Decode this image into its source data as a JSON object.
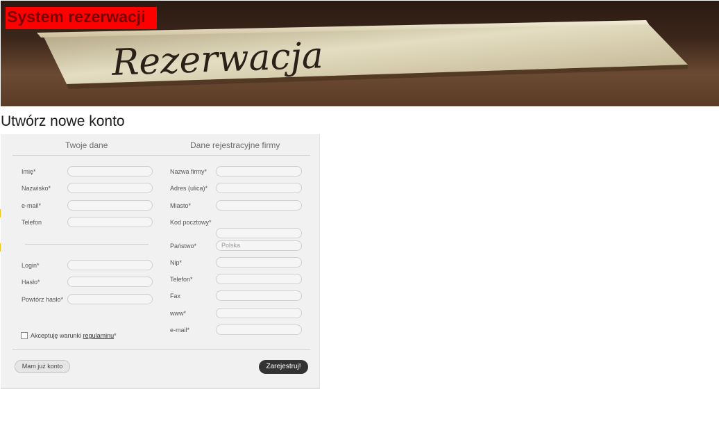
{
  "header": {
    "brand_title": "System rezerwacji",
    "banner_text": "Rezerwacja"
  },
  "page": {
    "heading": "Utwórz nowe konto"
  },
  "form": {
    "left_column_title": "Twoje dane",
    "right_column_title": "Dane rejestracyjne firmy",
    "personal": {
      "first_name_label": "Imię*",
      "last_name_label": "Nazwisko*",
      "email_label": "e-mail*",
      "phone_label": "Telefon",
      "login_label": "Login*",
      "password_label": "Hasło*",
      "password_repeat_label": "Powtórz hasło*"
    },
    "company": {
      "name_label": "Nazwa firmy*",
      "street_label": "Adres (ulica)*",
      "city_label": "Miasto*",
      "postal_label": "Kod pocztowy*",
      "country_label": "Państwo*",
      "country_placeholder": "Polska",
      "nip_label": "Nip*",
      "phone_label": "Telefon*",
      "fax_label": "Fax",
      "www_label": "www*",
      "email_label": "e-mail*"
    },
    "terms": {
      "prefix": "Akceptuję warunki",
      "link": "regulaminu",
      "suffix": "*"
    },
    "buttons": {
      "have_account": "Mam już konto",
      "register": "Zarejestruj!"
    }
  },
  "colors": {
    "brand_box": "#ff0000",
    "brand_text": "#7a0000",
    "register_button": "#333333"
  }
}
